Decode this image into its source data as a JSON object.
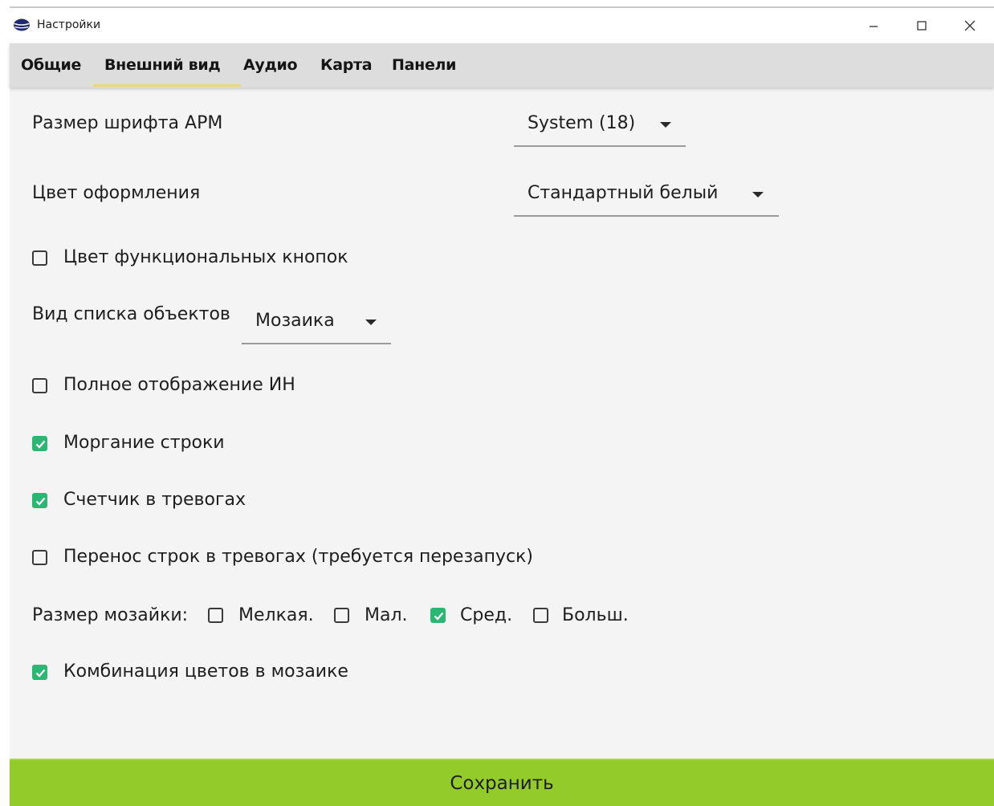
{
  "window": {
    "title": "Настройки",
    "minimize_symbol": "–",
    "maximize_symbol": "☐",
    "close_symbol": "✕"
  },
  "tabs": [
    {
      "label": "Общие"
    },
    {
      "label": "Внешний вид",
      "active": true
    },
    {
      "label": "Аудио"
    },
    {
      "label": "Карта"
    },
    {
      "label": "Панели"
    }
  ],
  "settings": {
    "font_size": {
      "label": "Размер шрифта АРМ",
      "value": "System (18)"
    },
    "theme": {
      "label": "Цвет  оформления",
      "value": "Стандартный белый"
    },
    "func_buttons_color": {
      "label": "Цвет функциональных кнопок",
      "checked": false
    },
    "object_list_view": {
      "label": "Вид списка объектов",
      "value": "Мозаика"
    },
    "full_in_display": {
      "label": "Полное отображение ИН",
      "checked": false
    },
    "line_blink": {
      "label": "Моргание строки",
      "checked": true
    },
    "alarm_counter": {
      "label": "Счетчик в тревогах",
      "checked": true
    },
    "line_wrap": {
      "label": "Перенос строк в тревогах (требуется перезапуск)",
      "checked": false
    },
    "mosaic_size": {
      "label": "Размер мозайки:",
      "options": [
        {
          "label": "Мелкая.",
          "checked": false
        },
        {
          "label": "Мал.",
          "checked": false
        },
        {
          "label": "Сред.",
          "checked": true
        },
        {
          "label": "Больш.",
          "checked": false
        }
      ]
    },
    "mosaic_colors": {
      "label": "Комбинация цветов в мозаике",
      "checked": true
    }
  },
  "save_button": {
    "label": "Сохранить"
  },
  "colors": {
    "accent_check": "#2bb673",
    "save_button": "#93cb2a",
    "tab_underline": "#e8d87a"
  },
  "icons": {
    "app": "globe-icon",
    "dropdown": "triangle-down-icon",
    "check": "checkmark-icon"
  }
}
